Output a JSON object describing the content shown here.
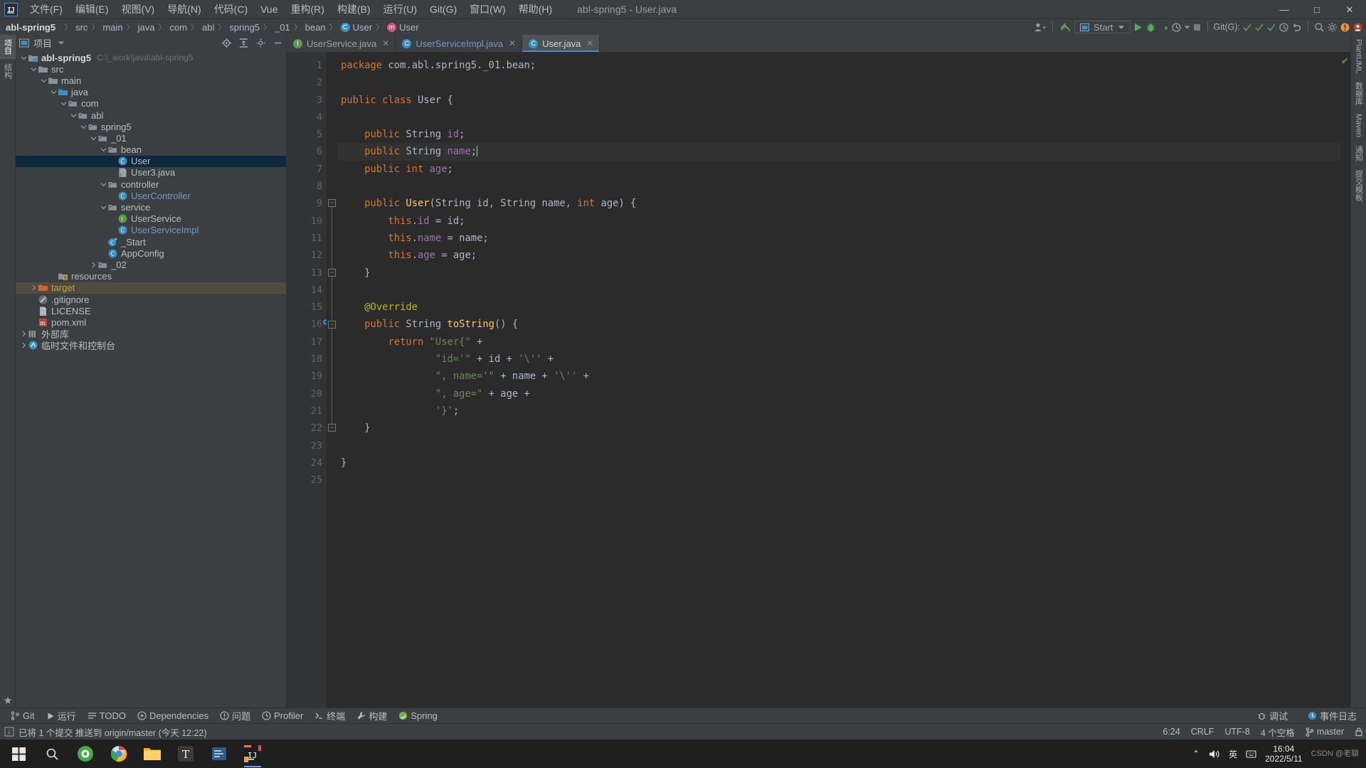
{
  "window": {
    "title": "abl-spring5 - User.java",
    "logo": "IJ",
    "buttons": {
      "minimize": "—",
      "maximize": "□",
      "close": "✕"
    }
  },
  "menu": {
    "items": [
      {
        "label": "文件(F)",
        "name": "menu-file"
      },
      {
        "label": "编辑(E)",
        "name": "menu-edit"
      },
      {
        "label": "视图(V)",
        "name": "menu-view"
      },
      {
        "label": "导航(N)",
        "name": "menu-navigate"
      },
      {
        "label": "代码(C)",
        "name": "menu-code"
      },
      {
        "label": "Vue",
        "name": "menu-vue"
      },
      {
        "label": "重构(R)",
        "name": "menu-refactor"
      },
      {
        "label": "构建(B)",
        "name": "menu-build"
      },
      {
        "label": "运行(U)",
        "name": "menu-run"
      },
      {
        "label": "Git(G)",
        "name": "menu-git"
      },
      {
        "label": "窗口(W)",
        "name": "menu-window"
      },
      {
        "label": "帮助(H)",
        "name": "menu-help"
      }
    ]
  },
  "breadcrumb": {
    "items": [
      "abl-spring5",
      "src",
      "main",
      "java",
      "com",
      "abl",
      "spring5",
      "_01",
      "bean",
      "User",
      "User"
    ],
    "separator": "〉",
    "class_badge": "C",
    "method_badge": "m"
  },
  "toolbar": {
    "run_config": "Start",
    "git_label": "Git(G):",
    "icons": [
      "profile-icon",
      "update-project-icon",
      "run-icon",
      "debug-icon",
      "coverage-icon",
      "settings-icon",
      "stop-icon",
      "git-commit-icon",
      "git-update-icon",
      "git-push-icon",
      "git-history-icon",
      "undo-icon",
      "search-everywhere-icon",
      "settings-gear-icon",
      "notifications-icon",
      "account-icon"
    ]
  },
  "project_panel": {
    "title": "项目",
    "header_icons": [
      "locate-icon",
      "collapse-all-icon",
      "settings-icon",
      "hide-icon"
    ],
    "tree": [
      {
        "depth": 0,
        "arrow": "v",
        "icon": "module-icon",
        "label": "abl-spring5",
        "bold": true,
        "path": "C:\\_work\\java\\abl-spring5",
        "name": "tree-node-abl-spring5"
      },
      {
        "depth": 1,
        "arrow": "v",
        "icon": "folder-icon",
        "label": "src",
        "name": "tree-node-src"
      },
      {
        "depth": 2,
        "arrow": "v",
        "icon": "folder-icon",
        "label": "main",
        "name": "tree-node-main"
      },
      {
        "depth": 3,
        "arrow": "v",
        "icon": "source-root-icon",
        "label": "java",
        "name": "tree-node-java"
      },
      {
        "depth": 4,
        "arrow": "v",
        "icon": "package-icon",
        "label": "com",
        "name": "tree-node-com"
      },
      {
        "depth": 5,
        "arrow": "v",
        "icon": "package-icon",
        "label": "abl",
        "name": "tree-node-abl"
      },
      {
        "depth": 6,
        "arrow": "v",
        "icon": "package-icon",
        "label": "spring5",
        "name": "tree-node-spring5"
      },
      {
        "depth": 7,
        "arrow": "v",
        "icon": "package-icon",
        "label": "_01",
        "name": "tree-node-01"
      },
      {
        "depth": 8,
        "arrow": "v",
        "icon": "package-icon",
        "label": "bean",
        "name": "tree-node-bean"
      },
      {
        "depth": 9,
        "arrow": "",
        "icon": "class-icon",
        "label": "User",
        "selected": true,
        "name": "tree-node-user"
      },
      {
        "depth": 9,
        "arrow": "",
        "icon": "java-file-icon",
        "label": "User3.java",
        "name": "tree-node-user3"
      },
      {
        "depth": 8,
        "arrow": "v",
        "icon": "package-icon",
        "label": "controller",
        "name": "tree-node-controller"
      },
      {
        "depth": 9,
        "arrow": "",
        "icon": "class-icon",
        "label": "UserController",
        "blue": true,
        "name": "tree-node-usercontroller"
      },
      {
        "depth": 8,
        "arrow": "v",
        "icon": "package-icon",
        "label": "service",
        "name": "tree-node-service"
      },
      {
        "depth": 9,
        "arrow": "",
        "icon": "interface-icon",
        "label": "UserService",
        "name": "tree-node-userservice"
      },
      {
        "depth": 9,
        "arrow": "",
        "icon": "class-icon",
        "label": "UserServiceImpl",
        "blue": true,
        "name": "tree-node-userserviceimpl"
      },
      {
        "depth": 8,
        "arrow": "",
        "icon": "runnable-class-icon",
        "label": "_Start",
        "name": "tree-node-start"
      },
      {
        "depth": 8,
        "arrow": "",
        "icon": "class-icon",
        "label": "AppConfig",
        "name": "tree-node-appconfig"
      },
      {
        "depth": 7,
        "arrow": ">",
        "icon": "package-icon",
        "label": "_02",
        "name": "tree-node-02"
      },
      {
        "depth": 3,
        "arrow": "",
        "icon": "resources-icon",
        "label": "resources",
        "name": "tree-node-resources"
      },
      {
        "depth": 1,
        "arrow": ">",
        "icon": "target-icon",
        "label": "target",
        "target": true,
        "name": "tree-node-target"
      },
      {
        "depth": 1,
        "arrow": "",
        "icon": "gitignore-icon",
        "label": ".gitignore",
        "name": "tree-node-gitignore"
      },
      {
        "depth": 1,
        "arrow": "",
        "icon": "file-icon",
        "label": "LICENSE",
        "name": "tree-node-license"
      },
      {
        "depth": 1,
        "arrow": "",
        "icon": "maven-icon",
        "label": "pom.xml",
        "name": "tree-node-pomxml"
      },
      {
        "depth": 0,
        "arrow": ">",
        "icon": "library-icon",
        "label": "外部库",
        "name": "tree-node-external-libraries"
      },
      {
        "depth": 0,
        "arrow": ">",
        "icon": "scratches-icon",
        "label": "临时文件和控制台",
        "name": "tree-node-scratches"
      }
    ]
  },
  "left_stripe": {
    "tabs": [
      "项目",
      "结构"
    ]
  },
  "right_stripe": {
    "tabs": [
      "PlantUML",
      "数据库",
      "Maven",
      "通知",
      "提交模板"
    ]
  },
  "editor": {
    "tabs": [
      {
        "label": "UserService.java",
        "badge": "I",
        "badge_color": "#5a9c4a",
        "active": false,
        "name": "tab-userservice"
      },
      {
        "label": "UserServiceImpl.java",
        "badge": "C",
        "badge_color": "#3592c4",
        "active": false,
        "blue": true,
        "name": "tab-userserviceimpl"
      },
      {
        "label": "User.java",
        "badge": "C",
        "badge_color": "#3592c4",
        "active": true,
        "name": "tab-user"
      }
    ],
    "close_glyph": "✕",
    "line_numbers": [
      1,
      2,
      3,
      4,
      5,
      6,
      7,
      8,
      9,
      10,
      11,
      12,
      13,
      14,
      15,
      16,
      17,
      18,
      19,
      20,
      21,
      22,
      23,
      24,
      25
    ],
    "highlight_line": 6,
    "override_marker_line": 16,
    "fold_lines": [
      9,
      13,
      16,
      22
    ],
    "code_lines": [
      {
        "n": 1,
        "tokens": [
          {
            "t": "kw",
            "v": "package"
          },
          {
            "t": "p",
            "v": " com.abl.spring5._01.bean;"
          }
        ]
      },
      {
        "n": 2,
        "tokens": []
      },
      {
        "n": 3,
        "tokens": [
          {
            "t": "kw",
            "v": "public class"
          },
          {
            "t": "p",
            "v": " User {"
          }
        ]
      },
      {
        "n": 4,
        "tokens": []
      },
      {
        "n": 5,
        "tokens": [
          {
            "t": "p",
            "v": "    "
          },
          {
            "t": "kw",
            "v": "public"
          },
          {
            "t": "p",
            "v": " String "
          },
          {
            "t": "fld",
            "v": "id"
          },
          {
            "t": "p",
            "v": ";"
          }
        ]
      },
      {
        "n": 6,
        "tokens": [
          {
            "t": "p",
            "v": "    "
          },
          {
            "t": "kw",
            "v": "public"
          },
          {
            "t": "p",
            "v": " String "
          },
          {
            "t": "fld",
            "v": "name"
          },
          {
            "t": "p",
            "v": ";"
          },
          {
            "t": "caret",
            "v": ""
          }
        ]
      },
      {
        "n": 7,
        "tokens": [
          {
            "t": "p",
            "v": "    "
          },
          {
            "t": "kw",
            "v": "public int"
          },
          {
            "t": "p",
            "v": " "
          },
          {
            "t": "fld",
            "v": "age"
          },
          {
            "t": "p",
            "v": ";"
          }
        ]
      },
      {
        "n": 8,
        "tokens": []
      },
      {
        "n": 9,
        "tokens": [
          {
            "t": "p",
            "v": "    "
          },
          {
            "t": "kw",
            "v": "public"
          },
          {
            "t": "p",
            "v": " "
          },
          {
            "t": "mth",
            "v": "User"
          },
          {
            "t": "p",
            "v": "(String id, String name, "
          },
          {
            "t": "kw",
            "v": "int"
          },
          {
            "t": "p",
            "v": " age) {"
          }
        ]
      },
      {
        "n": 10,
        "tokens": [
          {
            "t": "p",
            "v": "        "
          },
          {
            "t": "kw",
            "v": "this"
          },
          {
            "t": "p",
            "v": "."
          },
          {
            "t": "fld",
            "v": "id"
          },
          {
            "t": "p",
            "v": " = id;"
          }
        ]
      },
      {
        "n": 11,
        "tokens": [
          {
            "t": "p",
            "v": "        "
          },
          {
            "t": "kw",
            "v": "this"
          },
          {
            "t": "p",
            "v": "."
          },
          {
            "t": "fld",
            "v": "name"
          },
          {
            "t": "p",
            "v": " = name;"
          }
        ]
      },
      {
        "n": 12,
        "tokens": [
          {
            "t": "p",
            "v": "        "
          },
          {
            "t": "kw",
            "v": "this"
          },
          {
            "t": "p",
            "v": "."
          },
          {
            "t": "fld",
            "v": "age"
          },
          {
            "t": "p",
            "v": " = age;"
          }
        ]
      },
      {
        "n": 13,
        "tokens": [
          {
            "t": "p",
            "v": "    }"
          }
        ]
      },
      {
        "n": 14,
        "tokens": []
      },
      {
        "n": 15,
        "tokens": [
          {
            "t": "p",
            "v": "    "
          },
          {
            "t": "ann",
            "v": "@Override"
          }
        ]
      },
      {
        "n": 16,
        "tokens": [
          {
            "t": "p",
            "v": "    "
          },
          {
            "t": "kw",
            "v": "public"
          },
          {
            "t": "p",
            "v": " String "
          },
          {
            "t": "mth",
            "v": "toString"
          },
          {
            "t": "p",
            "v": "() {"
          }
        ]
      },
      {
        "n": 17,
        "tokens": [
          {
            "t": "p",
            "v": "        "
          },
          {
            "t": "kw",
            "v": "return"
          },
          {
            "t": "p",
            "v": " "
          },
          {
            "t": "str",
            "v": "\"User{\""
          },
          {
            "t": "p",
            "v": " +"
          }
        ]
      },
      {
        "n": 18,
        "tokens": [
          {
            "t": "p",
            "v": "                "
          },
          {
            "t": "str",
            "v": "\"id='\""
          },
          {
            "t": "p",
            "v": " + id + "
          },
          {
            "t": "str",
            "v": "'\\''"
          },
          {
            "t": "p",
            "v": " +"
          }
        ]
      },
      {
        "n": 19,
        "tokens": [
          {
            "t": "p",
            "v": "                "
          },
          {
            "t": "str",
            "v": "\", name='\""
          },
          {
            "t": "p",
            "v": " + name + "
          },
          {
            "t": "str",
            "v": "'\\''"
          },
          {
            "t": "p",
            "v": " +"
          }
        ]
      },
      {
        "n": 20,
        "tokens": [
          {
            "t": "p",
            "v": "                "
          },
          {
            "t": "str",
            "v": "\", age=\""
          },
          {
            "t": "p",
            "v": " + age +"
          }
        ]
      },
      {
        "n": 21,
        "tokens": [
          {
            "t": "p",
            "v": "                "
          },
          {
            "t": "str",
            "v": "'}'"
          },
          {
            "t": "p",
            "v": ";"
          }
        ]
      },
      {
        "n": 22,
        "tokens": [
          {
            "t": "p",
            "v": "    }"
          }
        ]
      },
      {
        "n": 23,
        "tokens": []
      },
      {
        "n": 24,
        "tokens": [
          {
            "t": "p",
            "v": "}"
          }
        ]
      },
      {
        "n": 25,
        "tokens": []
      }
    ]
  },
  "bottom_toolwindows": {
    "items": [
      {
        "label": "Git",
        "icon": "git-icon",
        "name": "toolwindow-git"
      },
      {
        "label": "运行",
        "icon": "run-icon",
        "name": "toolwindow-run"
      },
      {
        "label": "TODO",
        "icon": "todo-icon",
        "name": "toolwindow-todo"
      },
      {
        "label": "Dependencies",
        "icon": "dependencies-icon",
        "name": "toolwindow-dependencies"
      },
      {
        "label": "问题",
        "icon": "problems-icon",
        "name": "toolwindow-problems"
      },
      {
        "label": "Profiler",
        "icon": "profiler-icon",
        "name": "toolwindow-profiler"
      },
      {
        "label": "终端",
        "icon": "terminal-icon",
        "name": "toolwindow-terminal"
      },
      {
        "label": "构建",
        "icon": "build-icon",
        "name": "toolwindow-build"
      },
      {
        "label": "Spring",
        "icon": "spring-icon",
        "name": "toolwindow-spring"
      }
    ],
    "right_items": [
      {
        "label": "调试",
        "icon": "debug-icon",
        "name": "toolwindow-debug"
      },
      {
        "label": "事件日志",
        "icon": "event-log-icon",
        "name": "toolwindow-event-log"
      }
    ]
  },
  "status_bar": {
    "message": "已将 1 个提交 推送到 origin/master (今天 12:22)",
    "caret": "6:24",
    "line_separator": "CRLF",
    "encoding": "UTF-8",
    "indent": "4 个空格",
    "branch": "master",
    "lock_icon": "lock-icon"
  },
  "taskbar": {
    "icons": [
      {
        "name": "start-button",
        "glyph": "⊞",
        "color": "#ffffff"
      },
      {
        "name": "search-taskbar",
        "glyph": "○",
        "color": "#d8d8d8"
      },
      {
        "name": "browser-360-icon",
        "glyph": "",
        "color": "#4db84d"
      },
      {
        "name": "chrome-icon",
        "glyph": "",
        "color": "#4a8df0"
      },
      {
        "name": "file-explorer-icon",
        "glyph": "",
        "color": "#f0b429"
      },
      {
        "name": "typora-icon",
        "glyph": "T",
        "color": "#d8d8d8"
      },
      {
        "name": "editor-icon",
        "glyph": "",
        "color": "#6fa8dc"
      },
      {
        "name": "intellij-icon",
        "glyph": "IJ",
        "color": "#f07c3c",
        "active": true
      }
    ],
    "tray": {
      "ime": "英",
      "time": "16:04",
      "date": "2022/5/11",
      "chevron": "⌃"
    },
    "watermark": {
      "line1": "CSDN",
      "line2": "@老聊"
    }
  }
}
